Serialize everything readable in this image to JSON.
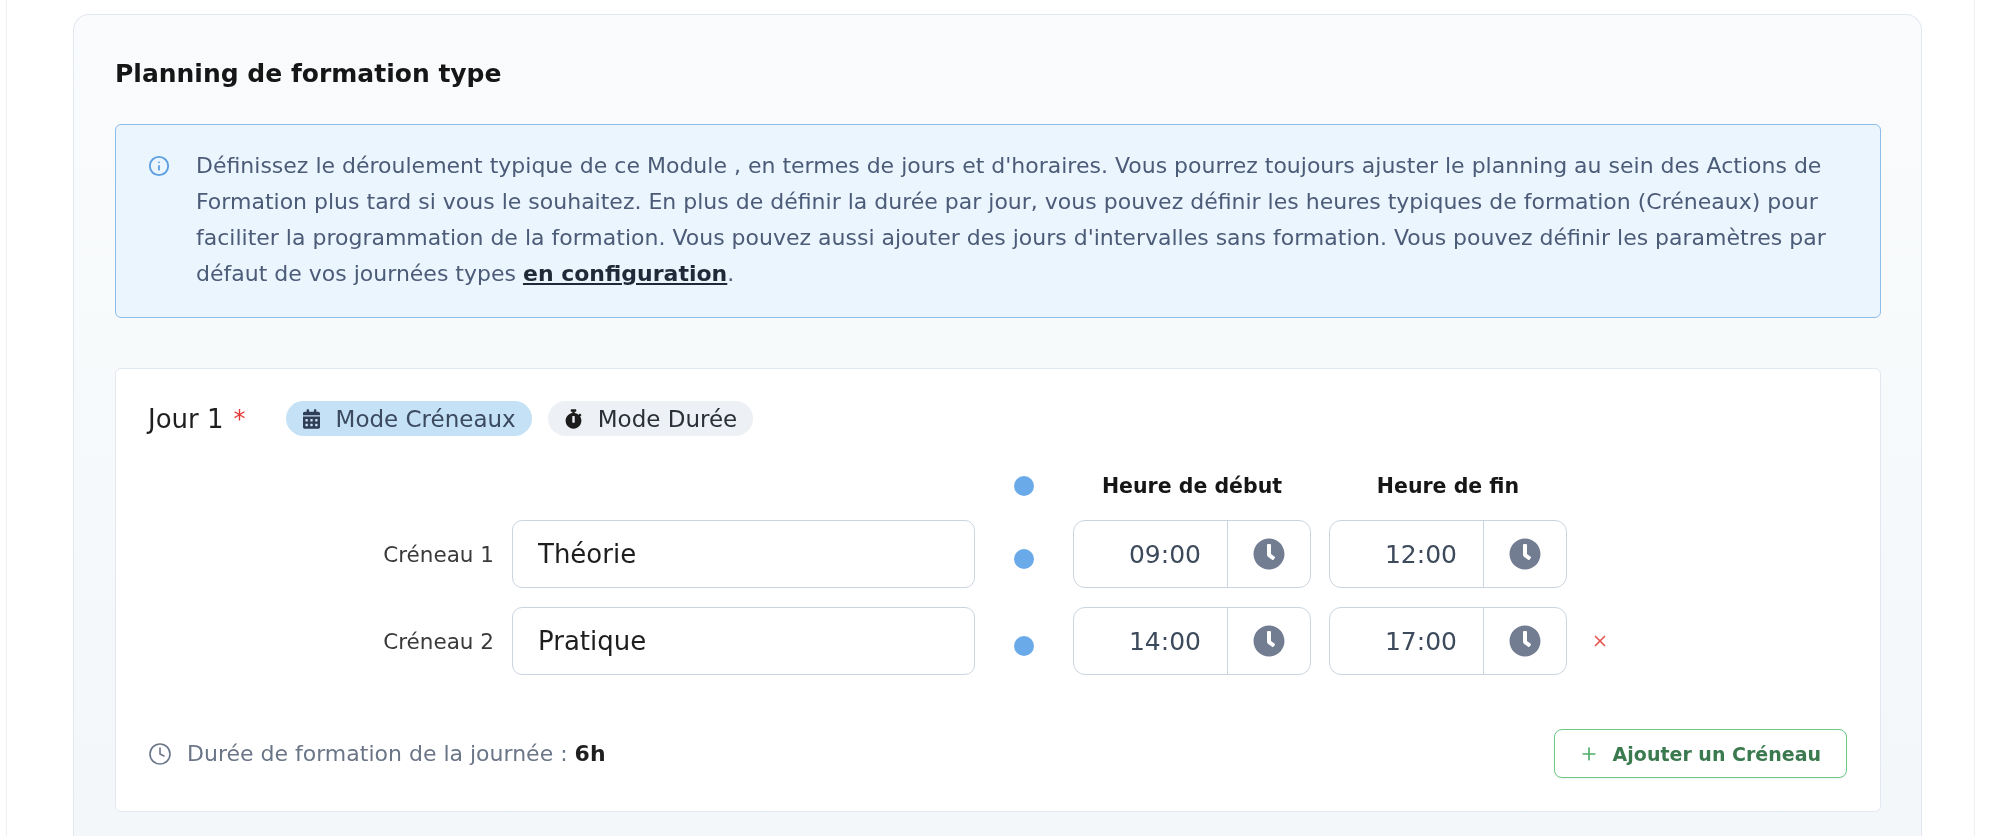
{
  "section": {
    "title": "Planning de formation type"
  },
  "info": {
    "text_before": "Définissez le déroulement typique de ce Module , en termes de jours et d'horaires. Vous pourrez toujours ajuster le planning au sein des Actions de Formation plus tard si vous le souhaitez. En plus de définir la durée par jour, vous pouvez définir les heures typiques de formation (Créneaux) pour faciliter la programmation de la formation. Vous pouvez aussi ajouter des jours d'intervalles sans formation. Vous pouvez définir les paramètres par défaut de vos journées types ",
    "link": "en configuration",
    "text_after": "."
  },
  "day": {
    "label": "Jour 1",
    "required_mark": "*",
    "modes": [
      {
        "label": "Mode Créneaux",
        "kind": "slots",
        "selected": true
      },
      {
        "label": "Mode Durée",
        "kind": "duration",
        "selected": false
      }
    ],
    "columns": [
      "Heure de début",
      "Heure de fin"
    ],
    "slots": [
      {
        "label": "Créneau 1",
        "name": "Théorie",
        "start": "09:00",
        "end": "12:00",
        "removable": false
      },
      {
        "label": "Créneau 2",
        "name": "Pratique",
        "start": "14:00",
        "end": "17:00",
        "removable": true
      }
    ],
    "total": "Durée de formation de la journée : **6h**",
    "add_button": "Ajouter un Créneau"
  }
}
